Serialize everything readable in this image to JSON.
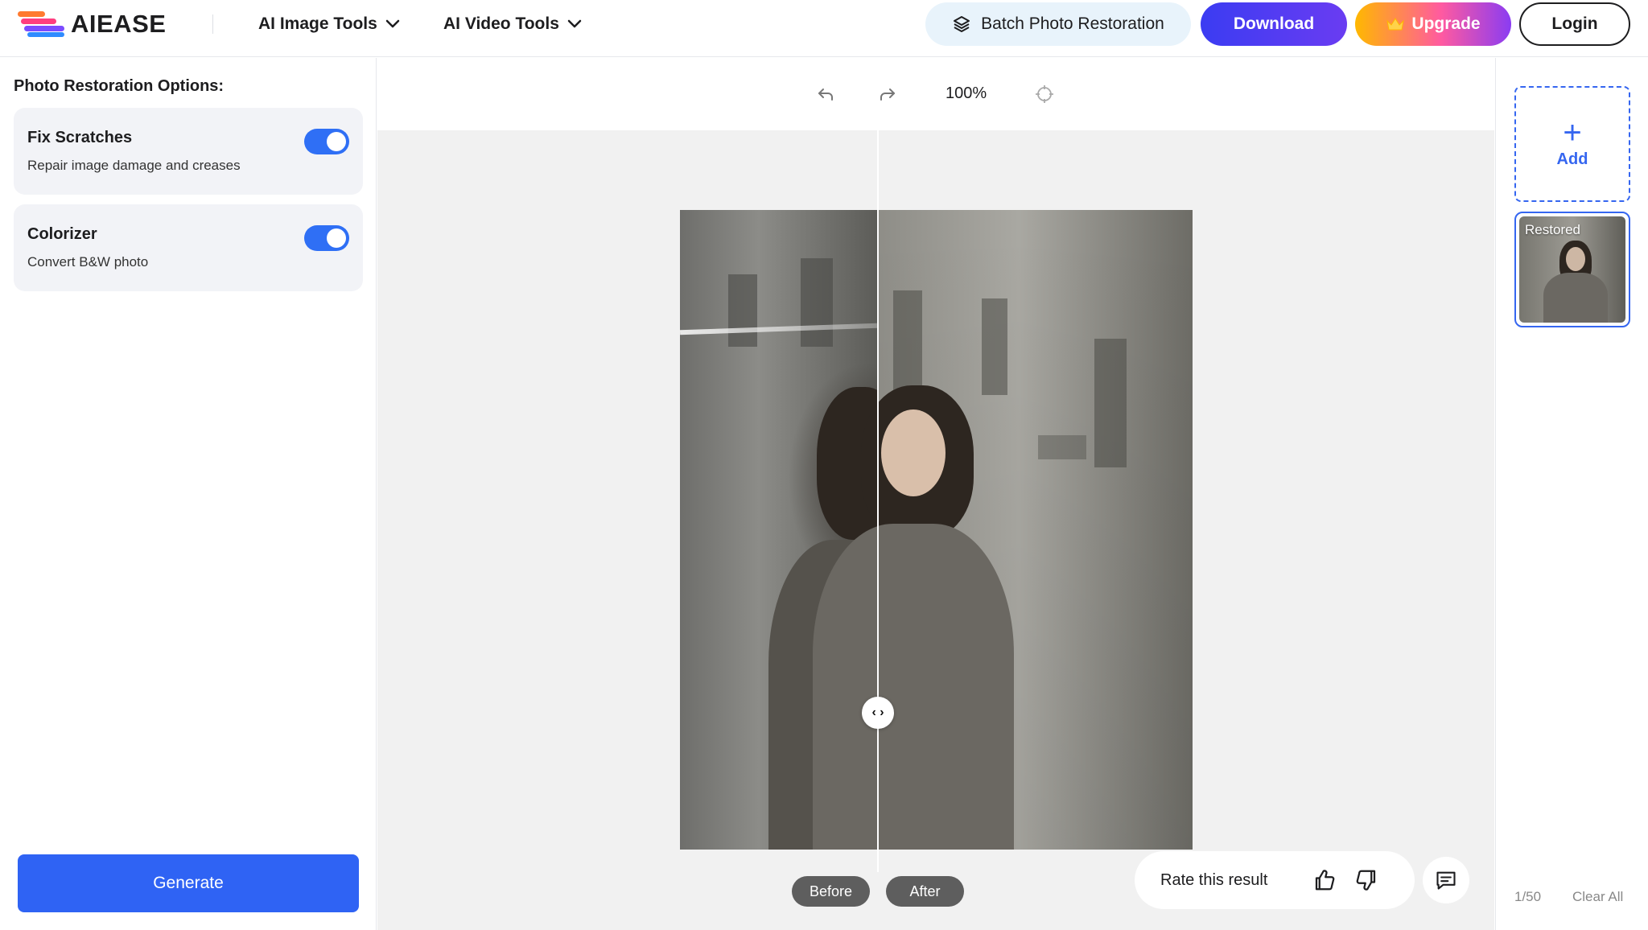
{
  "header": {
    "logo_text": "AIEASE",
    "nav": [
      {
        "label": "AI Image Tools",
        "icon": "chevron-down-icon"
      },
      {
        "label": "AI Video Tools",
        "icon": "chevron-down-icon"
      }
    ],
    "batch_label": "Batch Photo Restoration",
    "download_label": "Download",
    "upgrade_label": "Upgrade",
    "login_label": "Login"
  },
  "left_panel": {
    "title": "Photo Restoration Options:",
    "options": [
      {
        "title": "Fix Scratches",
        "description": "Repair image damage and creases",
        "enabled": true
      },
      {
        "title": "Colorizer",
        "description": "Convert B&W photo",
        "enabled": true
      }
    ],
    "generate_label": "Generate"
  },
  "toolbar": {
    "zoom": "100%",
    "icons": [
      "undo-icon",
      "redo-icon",
      "crosshair-icon"
    ]
  },
  "compare": {
    "before_label": "Before",
    "after_label": "After",
    "split_fraction": 0.38
  },
  "rating": {
    "label": "Rate this result"
  },
  "right_panel": {
    "add_label": "Add",
    "thumb_label": "Restored",
    "count": "1/50",
    "clear_label": "Clear All"
  },
  "colors": {
    "accent": "#2f63f4",
    "download_gradient": [
      "#3b3cf2",
      "#6a3cf2"
    ],
    "batch_bg": "#e8f3fb",
    "toggle_on": "#2f6ff5"
  }
}
